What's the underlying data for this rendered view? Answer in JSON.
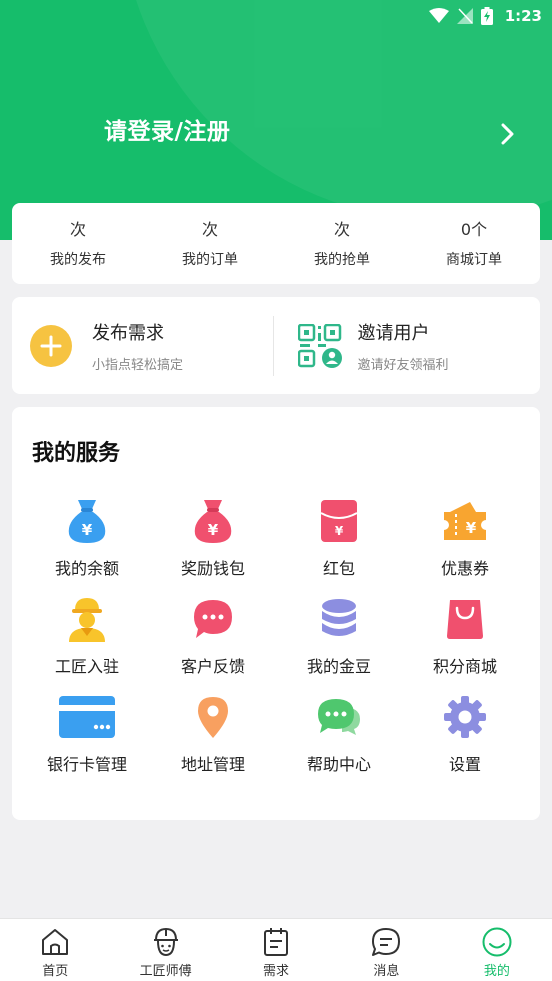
{
  "status_bar": {
    "time": "1:23"
  },
  "header": {
    "login_text": "请登录/注册"
  },
  "stats": [
    {
      "value": "次",
      "label": "我的发布"
    },
    {
      "value": "次",
      "label": "我的订单"
    },
    {
      "value": "次",
      "label": "我的抢单"
    },
    {
      "value": "0个",
      "label": "商城订单"
    }
  ],
  "actions": {
    "publish": {
      "title": "发布需求",
      "subtitle": "小指点轻松搞定"
    },
    "invite": {
      "title": "邀请用户",
      "subtitle": "邀请好友领福利"
    }
  },
  "services": {
    "title": "我的服务",
    "items": [
      {
        "label": "我的余额",
        "icon": "money-bag-icon"
      },
      {
        "label": "奖励钱包",
        "icon": "reward-bag-icon"
      },
      {
        "label": "红包",
        "icon": "red-envelope-icon"
      },
      {
        "label": "优惠券",
        "icon": "coupon-icon"
      },
      {
        "label": "工匠入驻",
        "icon": "worker-icon"
      },
      {
        "label": "客户反馈",
        "icon": "chat-bubble-icon"
      },
      {
        "label": "我的金豆",
        "icon": "coin-stack-icon"
      },
      {
        "label": "积分商城",
        "icon": "shopping-bag-icon"
      },
      {
        "label": "银行卡管理",
        "icon": "bank-card-icon"
      },
      {
        "label": "地址管理",
        "icon": "location-pin-icon"
      },
      {
        "label": "帮助中心",
        "icon": "help-chat-icon"
      },
      {
        "label": "设置",
        "icon": "gear-icon"
      }
    ]
  },
  "tabbar": [
    {
      "label": "首页",
      "icon": "home-icon",
      "active": false
    },
    {
      "label": "工匠师傅",
      "icon": "helmet-icon",
      "active": false
    },
    {
      "label": "需求",
      "icon": "clipboard-icon",
      "active": false
    },
    {
      "label": "消息",
      "icon": "message-icon",
      "active": false
    },
    {
      "label": "我的",
      "icon": "profile-smile-icon",
      "active": true
    }
  ],
  "colors": {
    "brand_green": "#16bd6b",
    "accent_yellow": "#f6c341",
    "service_blue": "#3a9ff0",
    "service_pink": "#f0506e",
    "service_orange": "#f8a530",
    "service_purple": "#8c8ee0",
    "service_green": "#4fc76e"
  }
}
